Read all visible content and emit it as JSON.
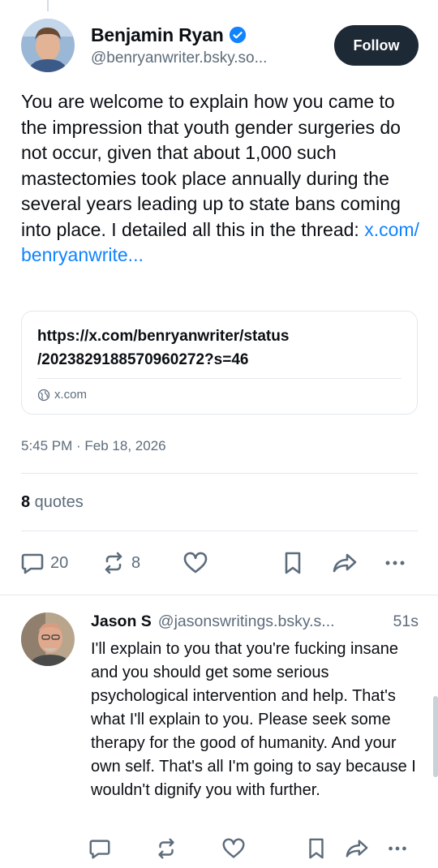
{
  "post": {
    "author_name": "Benjamin Ryan",
    "author_handle": "@benryanwriter.bsky.so...",
    "follow_label": "Follow",
    "text_main": "You are welcome to explain how you came to the impression that youth gender surgeries do not occur, given that about 1,000 such mastectomies took place annually during the several years leading up to state bans coming into place. I detailed all this in the thread: ",
    "text_link": "x.com/ benryanwrite...",
    "link_card": {
      "url": "https://x.com/benryanwriter/status /2023829188570960272?s=46",
      "domain": "x.com"
    },
    "timestamp": "5:45 PM · Feb 18, 2026",
    "quotes_count": "8",
    "quotes_label": " quotes",
    "actions": {
      "reply_count": "20",
      "repost_count": "8"
    }
  },
  "reply": {
    "author_name": "Jason S",
    "author_handle": "@jasonswritings.bsky.s...",
    "time": "51s",
    "text": "I'll explain to you that you're fucking insane and you should get some serious psychological intervention and help. That's what I'll explain to you. Please seek some therapy for the good of humanity. And your own self. That's all I'm going to say because I wouldn't dignify you with further."
  },
  "colors": {
    "link": "#1083fe",
    "verified": "#1083fe",
    "follow_bg": "#1e2936",
    "muted": "#5d6c7b"
  }
}
